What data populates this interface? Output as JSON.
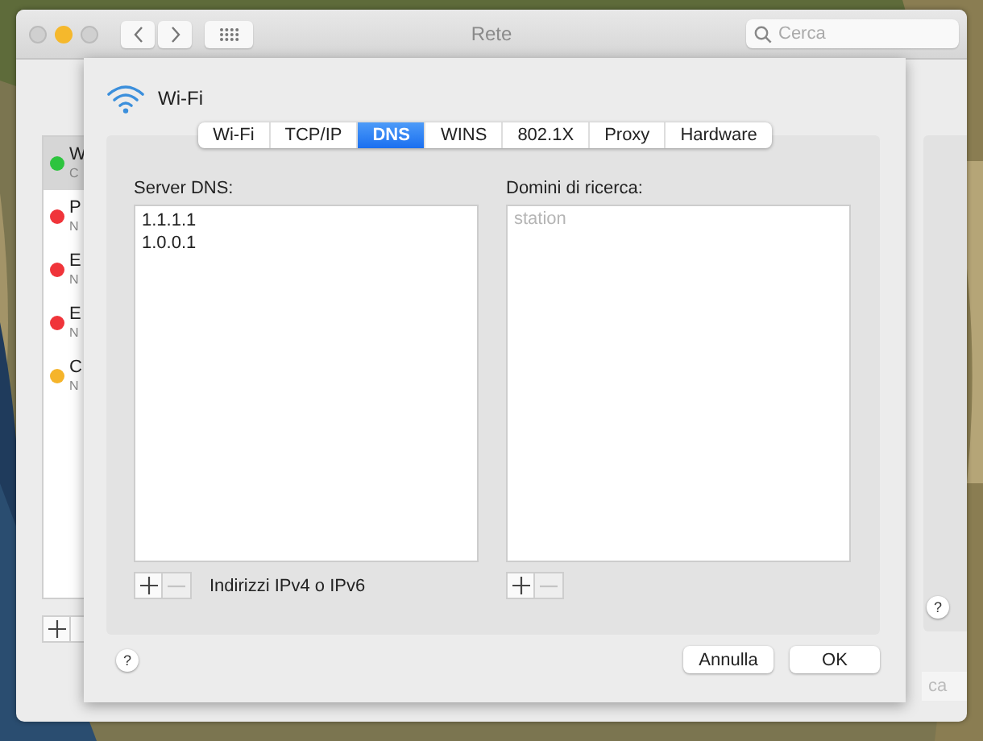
{
  "window": {
    "title": "Rete",
    "search": {
      "placeholder": "Cerca"
    }
  },
  "services": [
    {
      "title": "W",
      "subtitle": "C",
      "color": "#2dc43e",
      "selected": true
    },
    {
      "title": "P",
      "subtitle": "N",
      "color": "#f0343a",
      "selected": false
    },
    {
      "title": "E",
      "subtitle": "N",
      "color": "#f0343a",
      "selected": false
    },
    {
      "title": "E",
      "subtitle": "N",
      "color": "#f0343a",
      "selected": false
    },
    {
      "title": "C",
      "subtitle": "N",
      "color": "#f5b42a",
      "selected": false
    }
  ],
  "service_controls": [
    {
      "kind": "add",
      "disabled": false
    }
  ],
  "background_help": "?",
  "background_button": "ca",
  "sheet": {
    "interface": "Wi-Fi",
    "tabs": [
      {
        "label": "Wi-Fi",
        "selected": false
      },
      {
        "label": "TCP/IP",
        "selected": false
      },
      {
        "label": "DNS",
        "selected": true
      },
      {
        "label": "WINS",
        "selected": false
      },
      {
        "label": "802.1X",
        "selected": false
      },
      {
        "label": "Proxy",
        "selected": false
      },
      {
        "label": "Hardware",
        "selected": false
      }
    ],
    "dns_servers": {
      "label": "Server DNS:",
      "entries": [
        "1.1.1.1",
        "1.0.0.1"
      ],
      "controls": [
        {
          "kind": "add",
          "disabled": false
        },
        {
          "kind": "remove",
          "disabled": true
        }
      ],
      "hint": "Indirizzi IPv4 o IPv6"
    },
    "search_domains": {
      "label": "Domini di ricerca:",
      "placeholder": "station",
      "controls": [
        {
          "kind": "add",
          "disabled": false
        },
        {
          "kind": "remove",
          "disabled": true
        }
      ]
    },
    "help": "?",
    "buttons": [
      "Annulla",
      "OK"
    ]
  }
}
